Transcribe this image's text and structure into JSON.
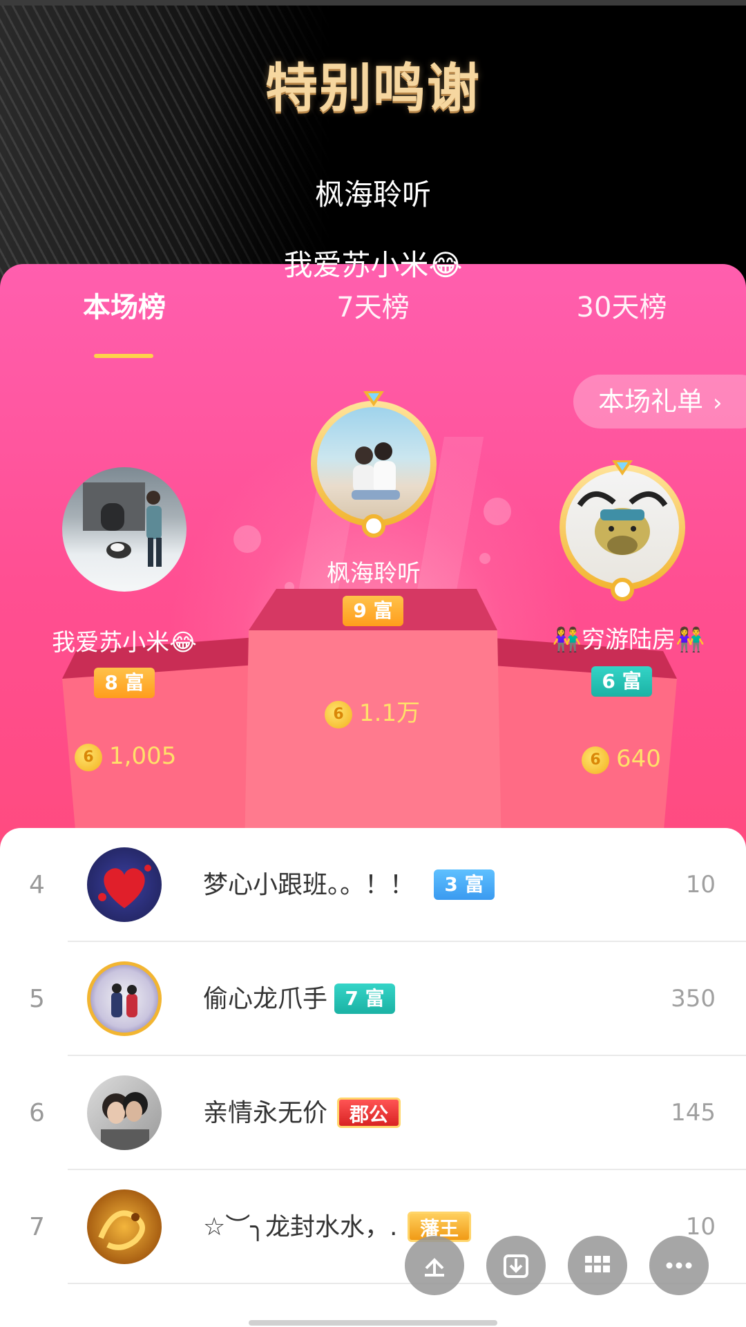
{
  "banner": {
    "title": "特别鸣谢",
    "names": [
      "枫海聆听",
      "我爱苏小米😂"
    ]
  },
  "tabs": [
    {
      "label": "本场榜",
      "active": true
    },
    {
      "label": "7天榜",
      "active": false
    },
    {
      "label": "30天榜",
      "active": false
    }
  ],
  "gift_list_button": {
    "label": "本场礼单",
    "icon": "chevron-right-icon"
  },
  "podium": {
    "first": {
      "rank": "1",
      "name": "枫海聆听",
      "badge": "9 富",
      "score": "1.1万"
    },
    "second": {
      "rank": "2",
      "name": "我爱苏小米😂",
      "badge": "8 富",
      "score": "1,005"
    },
    "third": {
      "rank": "3",
      "name": "👫穷游陆房👫",
      "badge": "6 富",
      "score": "640"
    }
  },
  "coin_symbol": "6",
  "list": [
    {
      "rank": "4",
      "name": "梦心小跟班。。！！",
      "badge": "3 富",
      "badge_style": "blue",
      "value": "10"
    },
    {
      "rank": "5",
      "name": "偷心龙爪手",
      "badge": "7 富",
      "badge_style": "teal",
      "value": "350"
    },
    {
      "rank": "6",
      "name": "亲情永无价",
      "badge": "郡公",
      "badge_style": "red",
      "value": "145"
    },
    {
      "rank": "7",
      "name": "☆︶╮龙封水水，.",
      "badge": "藩王",
      "badge_style": "gold",
      "value": "10"
    }
  ],
  "floating_actions": [
    "share-icon",
    "download-icon",
    "apps-grid-icon",
    "more-icon"
  ],
  "colors": {
    "panel_pink": "#ff4f92",
    "title_gold": "#f6d7a0",
    "score_yellow": "#ffe16a",
    "tab_underline": "#ffd24a"
  }
}
